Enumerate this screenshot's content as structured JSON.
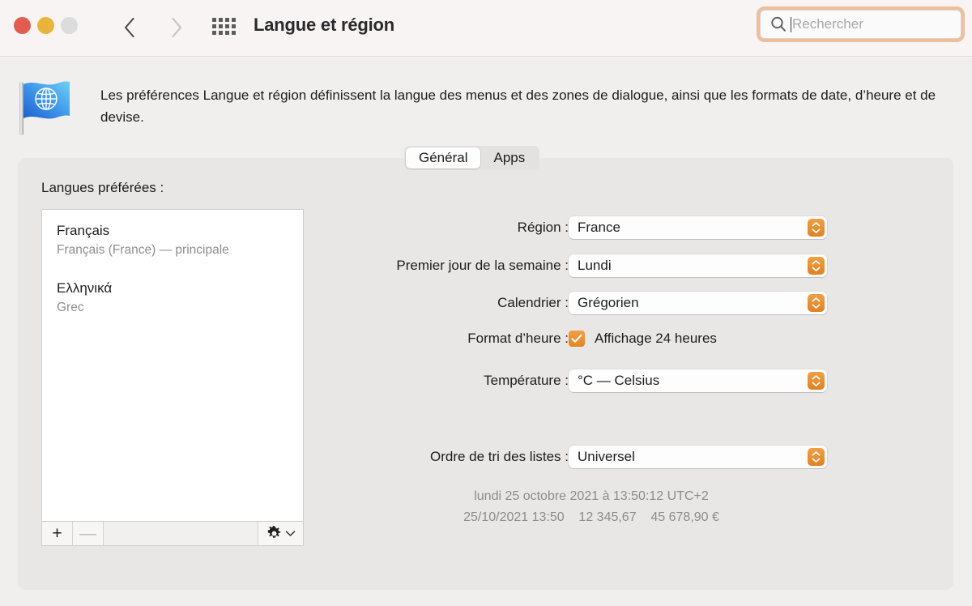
{
  "window": {
    "title": "Langue et région",
    "traffic_lights": [
      {
        "name": "close",
        "color": "#e25c50"
      },
      {
        "name": "minimize",
        "color": "#e9b43c"
      },
      {
        "name": "zoom",
        "color": "#dcdcdc"
      }
    ],
    "back_label": "Précédent",
    "forward_label": "Suivant",
    "grid_label": "Tout afficher"
  },
  "search": {
    "placeholder": "Rechercher",
    "value": "",
    "focus_ring_color": "#efbe9b"
  },
  "description": {
    "text": "Les préférences Langue et région définissent la langue des menus et des zones de dialogue, ainsi que les formats de date, d’heure et de devise.",
    "icon": "flag-globe-icon"
  },
  "tabs": [
    {
      "label": "Général",
      "selected": true
    },
    {
      "label": "Apps",
      "selected": false
    }
  ],
  "languages": {
    "section_label": "Langues préférées :",
    "items": [
      {
        "name": "Français",
        "subtitle": "Français (France) — principale"
      },
      {
        "name": "Ελληνικά",
        "subtitle": "Grec"
      }
    ],
    "toolbar": {
      "add_label": "+",
      "remove_label": "—",
      "add_enabled": true,
      "remove_enabled": false,
      "action_menu_icon": "gear-icon"
    }
  },
  "settings": {
    "region": {
      "label": "Région :",
      "value": "France"
    },
    "first_weekday": {
      "label": "Premier jour de la semaine :",
      "value": "Lundi"
    },
    "calendar": {
      "label": "Calendrier :",
      "value": "Grégorien"
    },
    "time_format": {
      "label": "Format d’heure :",
      "checkbox_label": "Affichage 24 heures",
      "checked": true
    },
    "temperature": {
      "label": "Température :",
      "value": "°C — Celsius"
    },
    "sort_order": {
      "label": "Ordre de tri des listes :",
      "value": "Universel"
    }
  },
  "preview": {
    "line1": "lundi 25 octobre 2021 à 13:50:12 UTC+2",
    "line2": "25/10/2021 13:50    12 345,67    45 678,90 €"
  },
  "colors": {
    "accent": "#e08124",
    "window_background": "#f0efee",
    "titlebar_background": "#f7f4f3",
    "panel_background": "#e8e7e6"
  }
}
